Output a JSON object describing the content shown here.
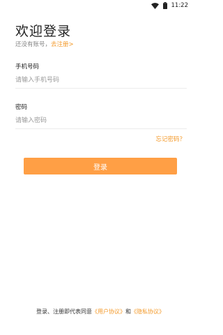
{
  "status_bar": {
    "time": "11:22",
    "icons": [
      "wifi-icon",
      "battery-icon"
    ]
  },
  "header": {
    "title": "欢迎登录",
    "no_account_text": "还没有账号，",
    "register_link": "去注册>"
  },
  "phone_field": {
    "label": "手机号码",
    "placeholder": "请输入手机号码",
    "value": ""
  },
  "password_field": {
    "label": "密码",
    "placeholder": "请输入密码",
    "value": ""
  },
  "forgot_password": "忘记密码？",
  "login_button": "登录",
  "agreement": {
    "prefix": "登录、注册即代表同意",
    "user_agreement": "《用户协议》",
    "conjunction": "和",
    "privacy_agreement": "《隐私协议》"
  },
  "colors": {
    "accent": "#f39a2b",
    "button_bg": "#ff9f45"
  }
}
